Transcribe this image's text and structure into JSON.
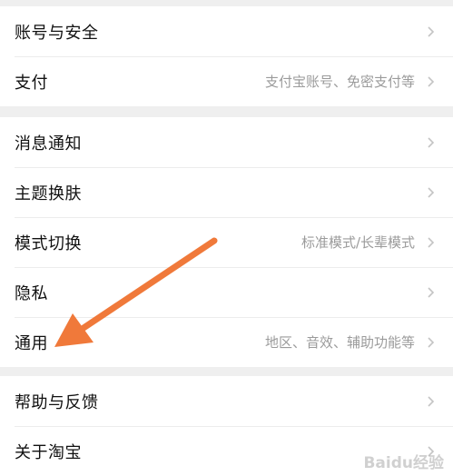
{
  "groups": [
    {
      "items": [
        {
          "label": "账号与安全",
          "detail": ""
        },
        {
          "label": "支付",
          "detail": "支付宝账号、免密支付等"
        }
      ]
    },
    {
      "items": [
        {
          "label": "消息通知",
          "detail": ""
        },
        {
          "label": "主题换肤",
          "detail": ""
        },
        {
          "label": "模式切换",
          "detail": "标准模式/长辈模式"
        },
        {
          "label": "隐私",
          "detail": ""
        },
        {
          "label": "通用",
          "detail": "地区、音效、辅助功能等"
        }
      ]
    },
    {
      "items": [
        {
          "label": "帮助与反馈",
          "detail": ""
        },
        {
          "label": "关于淘宝",
          "detail": ""
        }
      ]
    }
  ],
  "icons": {
    "chevron": "chevron-right-icon",
    "annotation": "arrow-pointer-annotation"
  },
  "colors": {
    "background": "#efefef",
    "row": "#ffffff",
    "label": "#111111",
    "detail": "#9b9b9b",
    "chevron": "#c4c4c4",
    "arrow": "#f0793a"
  },
  "watermark": "Baidu经验"
}
